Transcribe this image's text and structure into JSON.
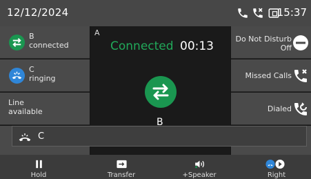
{
  "status_bar": {
    "date": "12/12/2024",
    "time": "15:37",
    "icons": [
      "phone-icon",
      "missed-call-icon",
      "tablet-icon"
    ]
  },
  "lines": [
    {
      "name": "B",
      "status": "connected",
      "icon": "transfer-icon",
      "color": "#1a9650"
    },
    {
      "name": "C",
      "status": "ringing",
      "icon": "ringing-icon",
      "color": "#2f86d8"
    },
    {
      "name": "Line",
      "status": "available",
      "icon": "",
      "color": ""
    }
  ],
  "active_call": {
    "line_label": "A",
    "state": "Connected",
    "duration": "00:13",
    "icon": "transfer-icon",
    "party": "B",
    "state_color": "#21a95a"
  },
  "features": [
    {
      "label_line1": "Do Not Disturb",
      "label_line2": "Off",
      "icon": "dnd-icon"
    },
    {
      "label_line1": "Missed Calls",
      "label_line2": "",
      "icon": "missed-call-icon"
    },
    {
      "label_line1": "Dialed",
      "label_line2": "",
      "icon": "dialed-icon"
    }
  ],
  "incoming": {
    "icon": "incoming-call-icon",
    "caller": "C"
  },
  "softkeys": [
    {
      "label": "Hold",
      "icon": "pause-icon"
    },
    {
      "label": "Transfer",
      "icon": "transfer-box-icon"
    },
    {
      "label": "+Speaker",
      "icon": "speaker-icon"
    },
    {
      "label": "Right",
      "icon": "right-icon"
    }
  ]
}
